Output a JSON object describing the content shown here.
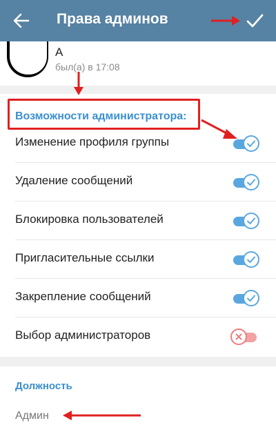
{
  "header": {
    "title": "Права админов",
    "back_icon": "arrow-left-icon",
    "done_icon": "check-icon",
    "background_color": "#5682a3"
  },
  "profile": {
    "name": "А",
    "status": "был(а) в 17:08"
  },
  "permissions": {
    "section_title": "Возможности администратора:",
    "items": [
      {
        "label": "Изменение профиля группы",
        "enabled": true
      },
      {
        "label": "Удаление сообщений",
        "enabled": true
      },
      {
        "label": "Блокировка пользователей",
        "enabled": true
      },
      {
        "label": "Пригласительные ссылки",
        "enabled": true
      },
      {
        "label": "Закрепление сообщений",
        "enabled": true
      },
      {
        "label": "Выбор администраторов",
        "enabled": false
      }
    ]
  },
  "position": {
    "title": "Должность",
    "placeholder": "Админ"
  },
  "colors": {
    "accent": "#3a8fd1",
    "toggle_on": "#5aa7e0",
    "toggle_off": "#f17b7b",
    "annotation": "#e02020"
  }
}
